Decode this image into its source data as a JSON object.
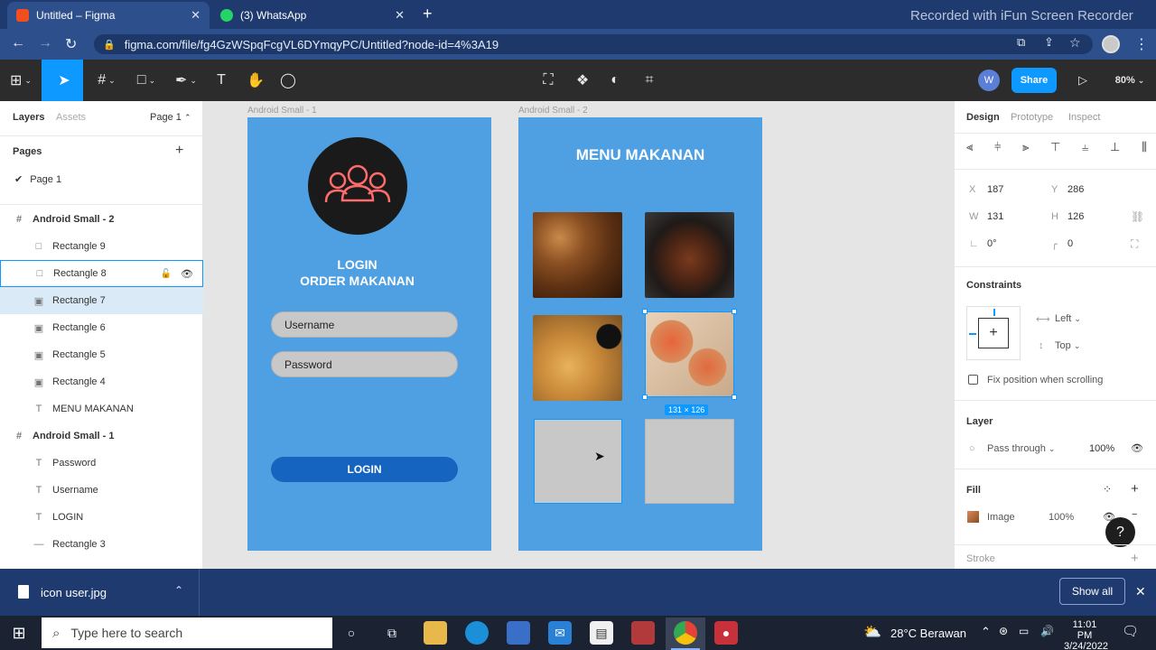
{
  "browser": {
    "tabs": [
      {
        "label": "Untitled – Figma",
        "active": true
      },
      {
        "label": "(3) WhatsApp",
        "active": false
      }
    ],
    "url": "figma.com/file/fg4GzWSpqFcgVL6DYmqyPC/Untitled?node-id=4%3A19",
    "watermark": "Recorded with iFun Screen Recorder"
  },
  "toolbar": {
    "avatar_initial": "W",
    "share_label": "Share",
    "zoom": "80%"
  },
  "left_panel": {
    "tab_layers": "Layers",
    "tab_assets": "Assets",
    "page_selector": "Page 1",
    "pages_heading": "Pages",
    "page_item": "Page 1",
    "layers": [
      {
        "label": "Android Small - 2",
        "icon": "frame-icon",
        "level": 0
      },
      {
        "label": "Rectangle 9",
        "icon": "rectangle-icon",
        "level": 1
      },
      {
        "label": "Rectangle 8",
        "icon": "rectangle-icon",
        "level": 1
      },
      {
        "label": "Rectangle 7",
        "icon": "image-icon",
        "level": 1
      },
      {
        "label": "Rectangle 6",
        "icon": "image-icon",
        "level": 1
      },
      {
        "label": "Rectangle 5",
        "icon": "image-icon",
        "level": 1
      },
      {
        "label": "Rectangle 4",
        "icon": "image-icon",
        "level": 1
      },
      {
        "label": "MENU MAKANAN",
        "icon": "text-icon",
        "level": 1
      },
      {
        "label": "Android Small - 1",
        "icon": "frame-icon",
        "level": 0
      },
      {
        "label": "Password",
        "icon": "text-icon",
        "level": 1
      },
      {
        "label": "Username",
        "icon": "text-icon",
        "level": 1
      },
      {
        "label": "LOGIN",
        "icon": "text-icon",
        "level": 1
      },
      {
        "label": "Rectangle 3",
        "icon": "line-icon",
        "level": 1
      }
    ]
  },
  "canvas": {
    "frame1": {
      "label": "Android Small - 1",
      "title_line1": "LOGIN",
      "title_line2": "ORDER MAKANAN",
      "username_placeholder": "Username",
      "password_placeholder": "Password",
      "login_button": "LOGIN"
    },
    "frame2": {
      "label": "Android Small - 2",
      "title": "MENU MAKANAN",
      "selection_size": "131 × 126"
    }
  },
  "right_panel": {
    "tabs": [
      "Design",
      "Prototype",
      "Inspect"
    ],
    "x_label": "X",
    "x_value": "187",
    "y_label": "Y",
    "y_value": "286",
    "w_label": "W",
    "w_value": "131",
    "h_label": "H",
    "h_value": "126",
    "rotation": "0°",
    "radius": "0",
    "constraints_heading": "Constraints",
    "constraint_h": "Left",
    "constraint_v": "Top",
    "fix_position_label": "Fix position when scrolling",
    "layer_heading": "Layer",
    "blend_mode": "Pass through",
    "layer_opacity": "100%",
    "fill_heading": "Fill",
    "fill_type": "Image",
    "fill_opacity": "100%",
    "stroke_heading": "Stroke"
  },
  "downloads": {
    "file_name": "icon user.jpg",
    "show_all": "Show all"
  },
  "taskbar": {
    "search_placeholder": "Type here to search",
    "weather": "28°C Berawan",
    "time": "11:01 PM",
    "date": "3/24/2022"
  },
  "colors": {
    "accent": "#0d99ff",
    "frame_blue": "#4fa0e3",
    "login_button": "#1565c0"
  }
}
